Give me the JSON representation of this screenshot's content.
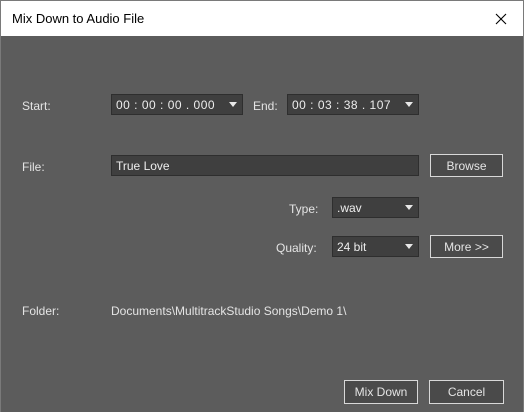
{
  "window": {
    "title": "Mix Down to Audio File"
  },
  "range": {
    "start_label": "Start:",
    "start_value": "00 : 00 : 00 . 000",
    "end_label": "End:",
    "end_value": "00 : 03 : 38 . 107"
  },
  "file": {
    "label": "File:",
    "name": "True Love",
    "browse_label": "Browse"
  },
  "type": {
    "label": "Type:",
    "value": ".wav"
  },
  "quality": {
    "label": "Quality:",
    "value": "24 bit",
    "more_label": "More >>"
  },
  "folder": {
    "label": "Folder:",
    "path": "Documents\\MultitrackStudio Songs\\Demo 1\\"
  },
  "actions": {
    "mixdown_label": "Mix Down",
    "cancel_label": "Cancel"
  },
  "icons": {
    "close": "close-icon",
    "dropdown": "caret-down-icon"
  }
}
